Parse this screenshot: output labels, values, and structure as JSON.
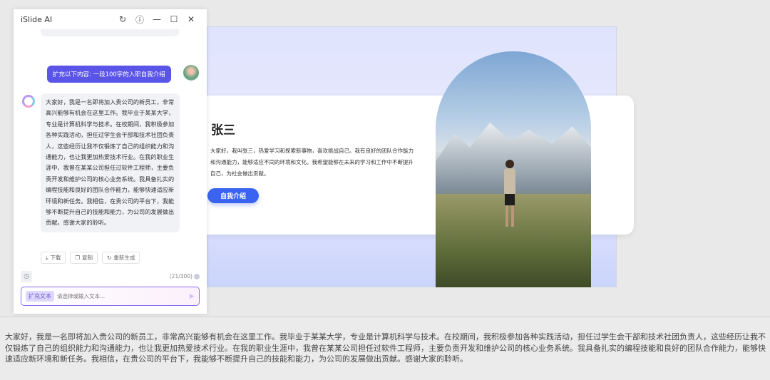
{
  "chat": {
    "title": "iSlide AI",
    "user_message": "扩充以下内容: 一段100字的入职自我介绍",
    "ai_message": "大家好，我是一名即将加入贵公司的新员工，非常高兴能够有机会在这里工作。我毕业于某某大学，专业是计算机科学与技术。在校期间，我积极参加各种实践活动，担任过学生会干部和技术社团负责人，这些经历让我不仅锻炼了自己的组织能力和沟通能力，也让我更加热爱技术行业。在我的职业生涯中，我曾在某某公司担任过软件工程师，主要负责开发和维护公司的核心业务系统。我具备扎实的编程技能和良好的团队合作能力，能够快速适应新环境和新任务。我相信，在贵公司的平台下，我能够不断提升自己的技能和能力，为公司的发展做出贡献。感谢大家的聆听。",
    "actions": {
      "download": "下载",
      "copy": "复制",
      "regenerate": "重新生成"
    },
    "char_count": "(21/300)",
    "input_tag": "扩充文本",
    "input_placeholder": "请选择或输入文本..."
  },
  "slide": {
    "name": "张三",
    "description": "大家好，我叫张三，热爱学习和探索新事物，喜欢挑战自己。我有良好的团队合作能力和沟通能力，能够适应不同的环境和文化。我希望能够在未来的学习和工作中不断提升自己，为社会做出贡献。",
    "button": "自我介绍"
  },
  "bottom_text": "大家好，我是一名即将加入贵公司的新员工，非常高兴能够有机会在这里工作。我毕业于某某大学，专业是计算机科学与技术。在校期间，我积极参加各种实践活动，担任过学生会干部和技术社团负责人，这些经历让我不仅锻炼了自己的组织能力和沟通能力，也让我更加热爱技术行业。在我的职业生涯中，我曾在某某公司担任过软件工程师，主要负责开发和维护公司的核心业务系统。我具备扎实的编程技能和良好的团队合作能力，能够快速适应新环境和新任务。我相信，在贵公司的平台下，我能够不断提升自己的技能和能力，为公司的发展做出贡献。感谢大家的聆听。"
}
